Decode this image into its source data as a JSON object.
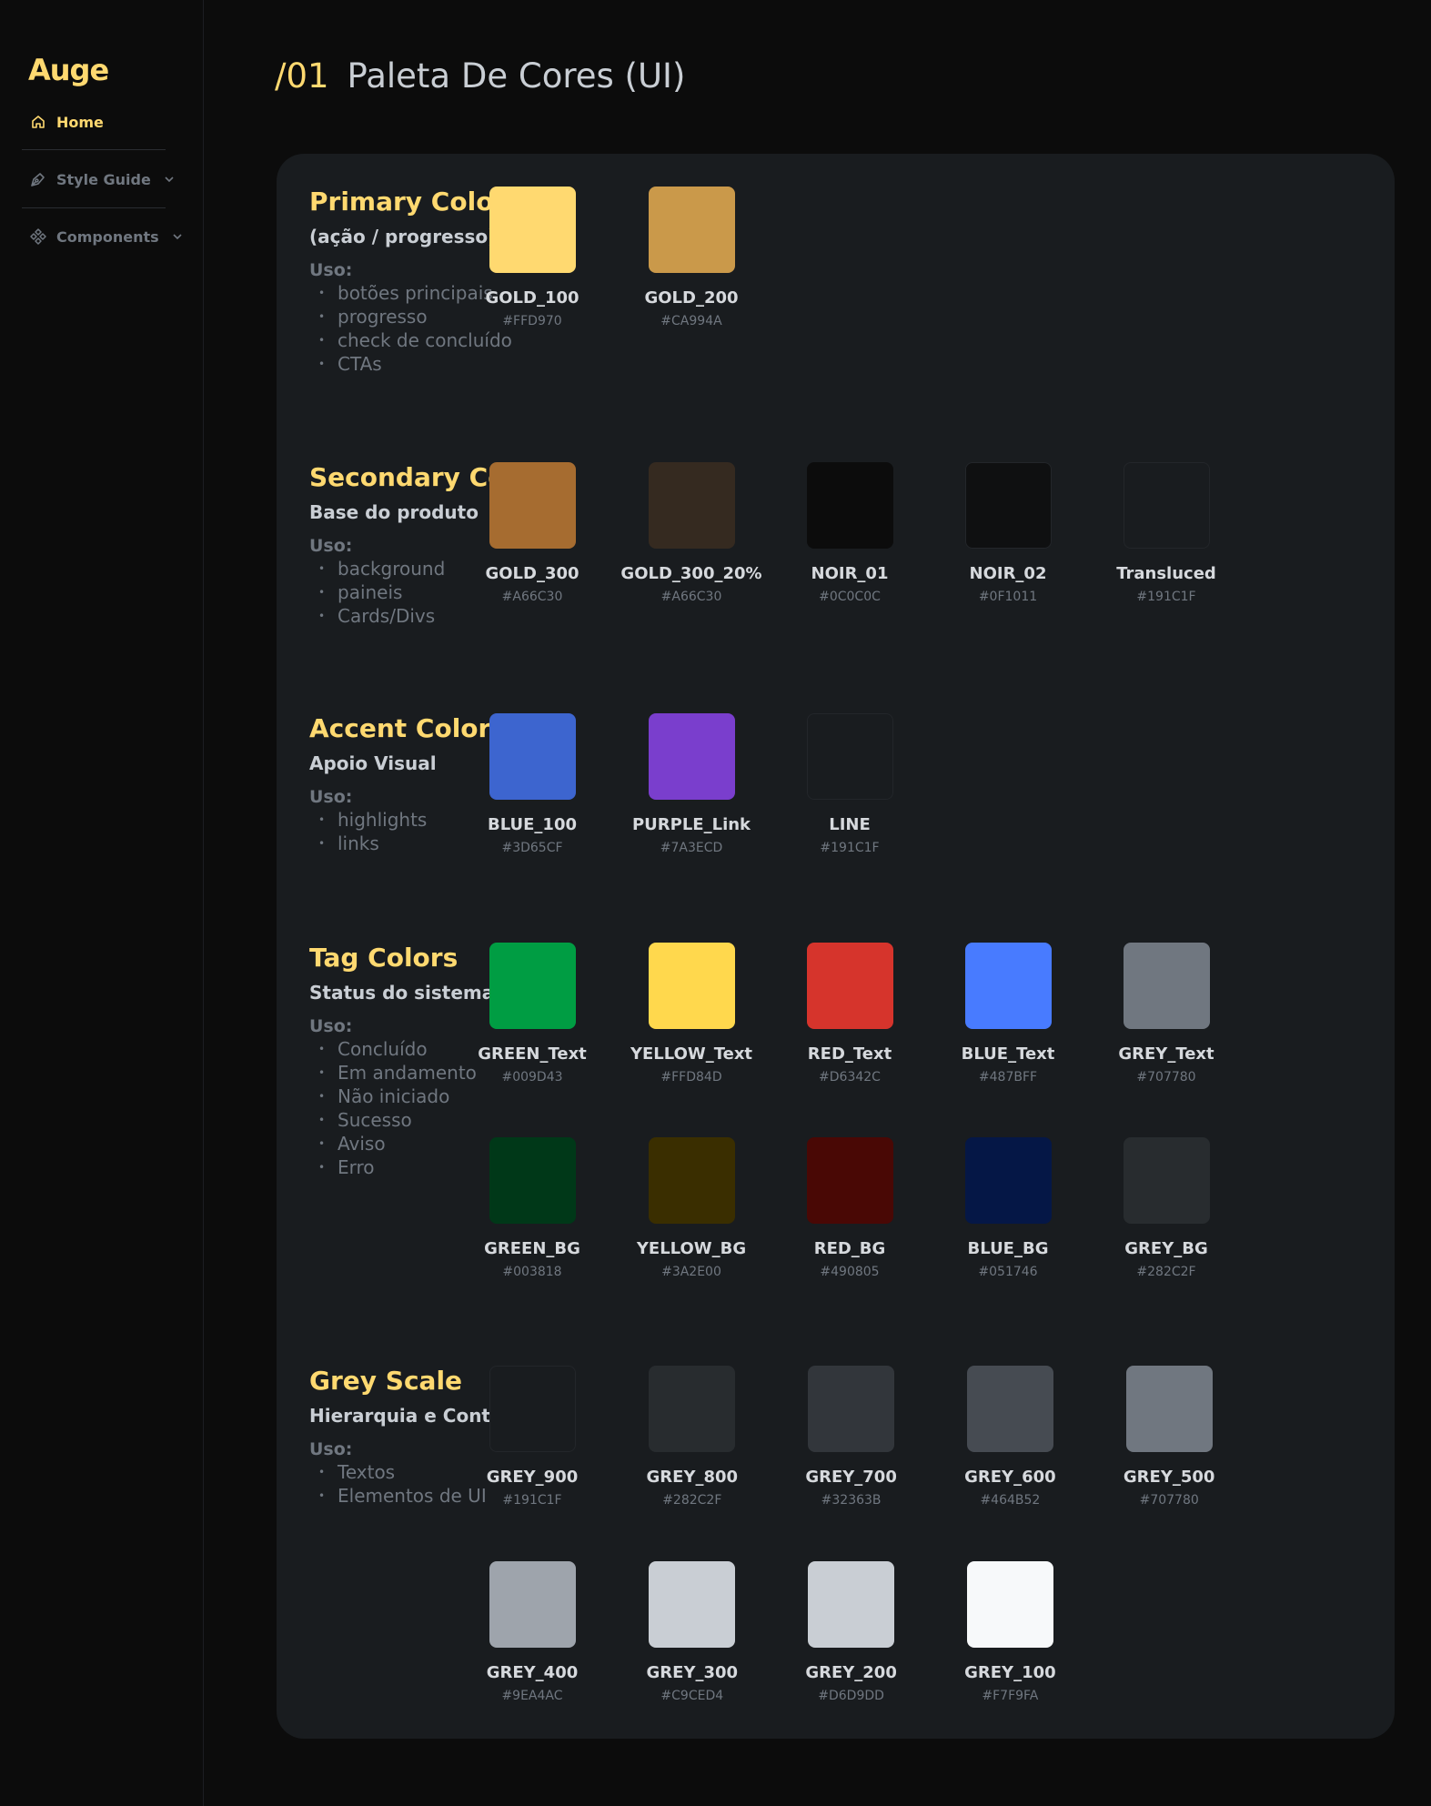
{
  "sidebar": {
    "logo": "Auge",
    "items": [
      {
        "label": "Home",
        "icon": "home-icon"
      },
      {
        "label": "Style Guide",
        "icon": "pen-tool-icon"
      },
      {
        "label": "Components",
        "icon": "components-icon"
      }
    ]
  },
  "header": {
    "number": "/01",
    "title": "Paleta De Cores (UI)"
  },
  "sections": [
    {
      "title": "Primary Colors",
      "subtitle": "(ação / progresso)",
      "uso_label": "Uso:",
      "uses": [
        "botões principais",
        "progresso",
        "check de concluído",
        "CTAs"
      ],
      "swatches": [
        {
          "name": "GOLD_100",
          "hex": "#FFD970",
          "color": "#FFD970"
        },
        {
          "name": "GOLD_200",
          "hex": "#CA994A",
          "color": "#CA994A"
        }
      ]
    },
    {
      "title": "Secondary Colors",
      "subtitle": "Base do produto",
      "uso_label": "Uso:",
      "uses": [
        "background",
        "paineis",
        "Cards/Divs"
      ],
      "swatches": [
        {
          "name": "GOLD_300",
          "hex": "#A66C30",
          "color": "#A66C30"
        },
        {
          "name": "GOLD_300_20%",
          "hex": "#A66C30",
          "color": "#352A20"
        },
        {
          "name": "NOIR_01",
          "hex": "#0C0C0C",
          "color": "#0C0C0C"
        },
        {
          "name": "NOIR_02",
          "hex": "#0F1011",
          "color": "#0F1011"
        },
        {
          "name": "Transluced",
          "hex": "#191C1F",
          "color": "#191C1F"
        }
      ]
    },
    {
      "title": "Accent Colors",
      "subtitle": "Apoio Visual",
      "uso_label": "Uso:",
      "uses": [
        "highlights",
        "links"
      ],
      "swatches": [
        {
          "name": "BLUE_100",
          "hex": "#3D65CF",
          "color": "#3D65CF"
        },
        {
          "name": "PURPLE_Link",
          "hex": "#7A3ECD",
          "color": "#7A3ECD"
        },
        {
          "name": "LINE",
          "hex": "#191C1F",
          "color": "#191C1F"
        }
      ]
    },
    {
      "title": "Tag Colors",
      "subtitle": "Status do sistema",
      "uso_label": "Uso:",
      "uses": [
        "Concluído",
        "Em andamento",
        "Não iniciado",
        "Sucesso",
        "Aviso",
        "Erro"
      ],
      "swatches": [
        {
          "name": "GREEN_Text",
          "hex": "#009D43",
          "color": "#009D43"
        },
        {
          "name": "YELLOW_Text",
          "hex": "#FFD84D",
          "color": "#FFD84D"
        },
        {
          "name": "RED_Text",
          "hex": "#D6342C",
          "color": "#D6342C"
        },
        {
          "name": "BLUE_Text",
          "hex": "#487BFF",
          "color": "#487BFF"
        },
        {
          "name": "GREY_Text",
          "hex": "#707780",
          "color": "#707780"
        },
        {
          "name": "GREEN_BG",
          "hex": "#003818",
          "color": "#003818"
        },
        {
          "name": "YELLOW_BG",
          "hex": "#3A2E00",
          "color": "#3A2E00"
        },
        {
          "name": "RED_BG",
          "hex": "#490805",
          "color": "#490805"
        },
        {
          "name": "BLUE_BG",
          "hex": "#051746",
          "color": "#051746"
        },
        {
          "name": "GREY_BG",
          "hex": "#282C2F",
          "color": "#282C2F"
        }
      ]
    },
    {
      "title": "Grey Scale",
      "subtitle": "Hierarquia e Contraste",
      "uso_label": "Uso:",
      "uses": [
        "Textos",
        "Elementos de UI"
      ],
      "swatches": [
        {
          "name": "GREY_900",
          "hex": "#191C1F",
          "color": "#191C1F"
        },
        {
          "name": "GREY_800",
          "hex": "#282C2F",
          "color": "#282C2F"
        },
        {
          "name": "GREY_700",
          "hex": "#32363B",
          "color": "#32363B"
        },
        {
          "name": "GREY_600",
          "hex": "#464B52",
          "color": "#464B52"
        },
        {
          "name": "GREY_500",
          "hex": "#707780",
          "color": "#707780"
        },
        {
          "name": "GREY_400",
          "hex": "#9EA4AC",
          "color": "#9EA4AC"
        },
        {
          "name": "GREY_300",
          "hex": "#C9CED4",
          "color": "#C9CED4"
        },
        {
          "name": "GREY_200",
          "hex": "#D6D9DD",
          "color": "#C9CED4"
        },
        {
          "name": "GREY_100",
          "hex": "#F7F9FA",
          "color": "#F7F9FA"
        }
      ]
    }
  ]
}
